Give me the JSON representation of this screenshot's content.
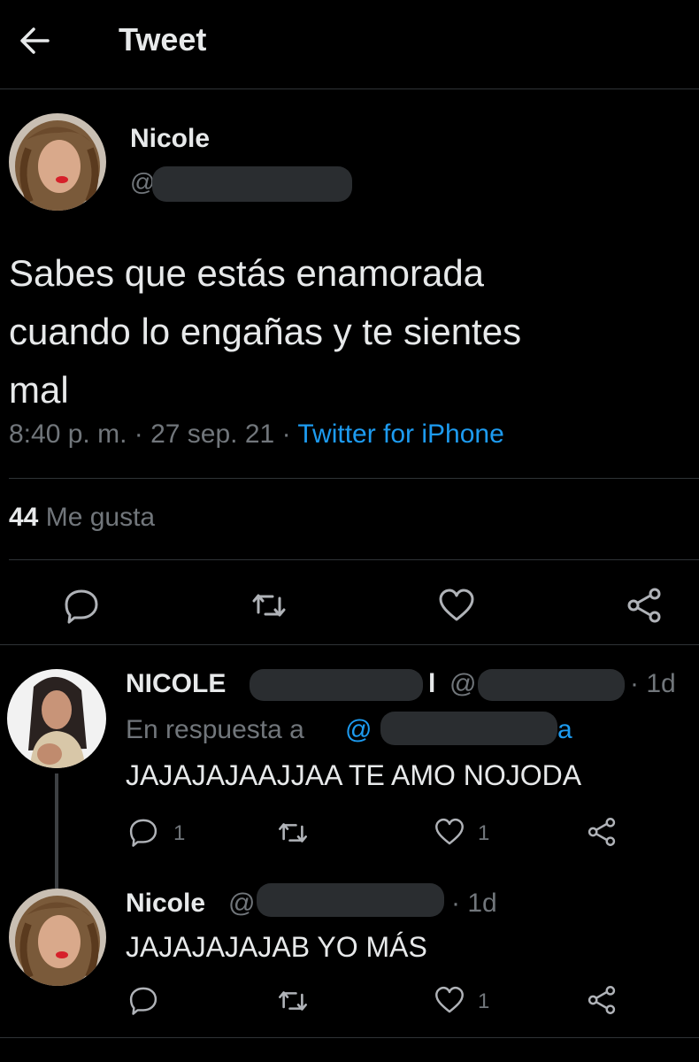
{
  "header": {
    "title": "Tweet",
    "back_icon": "arrow-left-icon"
  },
  "tweet": {
    "author_name": "Nicole",
    "handle_prefix": "@",
    "text_line1": "Sabes que estás enamorada",
    "text_line2": "cuando lo engañas y te sientes",
    "text_line3": "mal",
    "time": "8:40 p. m.",
    "sep1": "·",
    "date": "27 sep. 21",
    "sep2": "·",
    "source": "Twitter for iPhone",
    "likes_count": "44",
    "likes_label": "Me gusta",
    "actions": [
      "reply-icon",
      "retweet-icon",
      "heart-icon",
      "share-icon"
    ]
  },
  "replies": [
    {
      "name": "NICOLE",
      "name_tail": "l",
      "handle_prefix": "@",
      "time": "· 1d",
      "in_reply_prefix": "En respuesta a",
      "in_reply_handle": "@",
      "in_reply_tail": "a",
      "text": "JAJAJAJAAJJAA TE AMO NOJODA",
      "reply_count": "1",
      "like_count": "1"
    },
    {
      "name": "Nicole",
      "handle_prefix": "@",
      "time": "· 1d",
      "text": "JAJAJAJAJAB YO MÁS",
      "like_count": "1"
    }
  ],
  "colors": {
    "background": "#000000",
    "text": "#e7e9ea",
    "muted": "#71767b",
    "link": "#1d9bf0",
    "border": "#2f3336"
  }
}
